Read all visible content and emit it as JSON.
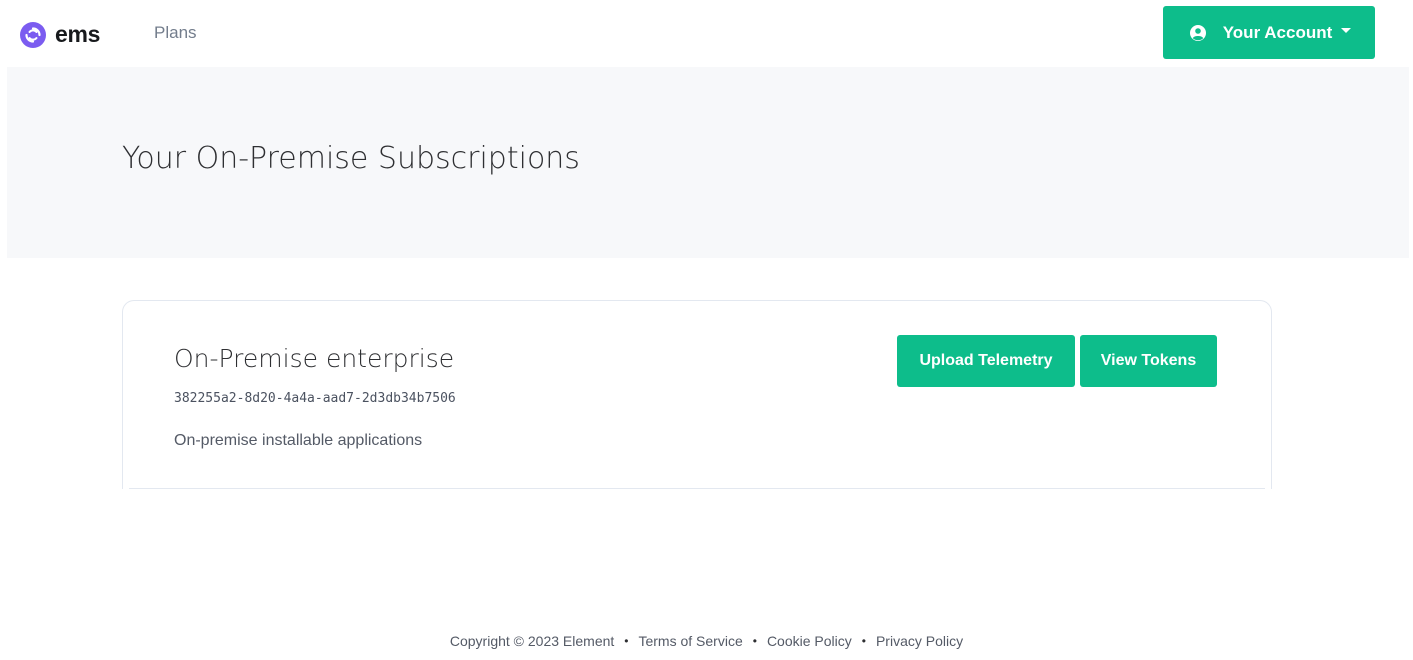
{
  "brand": {
    "name": "ems",
    "logo_icon": "element-logo-icon",
    "logo_color": "#7b5cf0"
  },
  "nav": {
    "plans_label": "Plans"
  },
  "account": {
    "label": "Your Account",
    "icon": "user-circle-icon",
    "color": "#0dbd8b"
  },
  "hero": {
    "title": "Your On-Premise Subscriptions"
  },
  "subscription": {
    "title": "On-Premise enterprise",
    "id": "382255a2-8d20-4a4a-aad7-2d3db34b7506",
    "description": "On-premise installable applications",
    "upload_label": "Upload Telemetry",
    "tokens_label": "View Tokens"
  },
  "footer": {
    "copyright": "Copyright © 2023 Element",
    "terms": "Terms of Service",
    "cookie": "Cookie Policy",
    "privacy": "Privacy Policy",
    "separator": "•"
  }
}
